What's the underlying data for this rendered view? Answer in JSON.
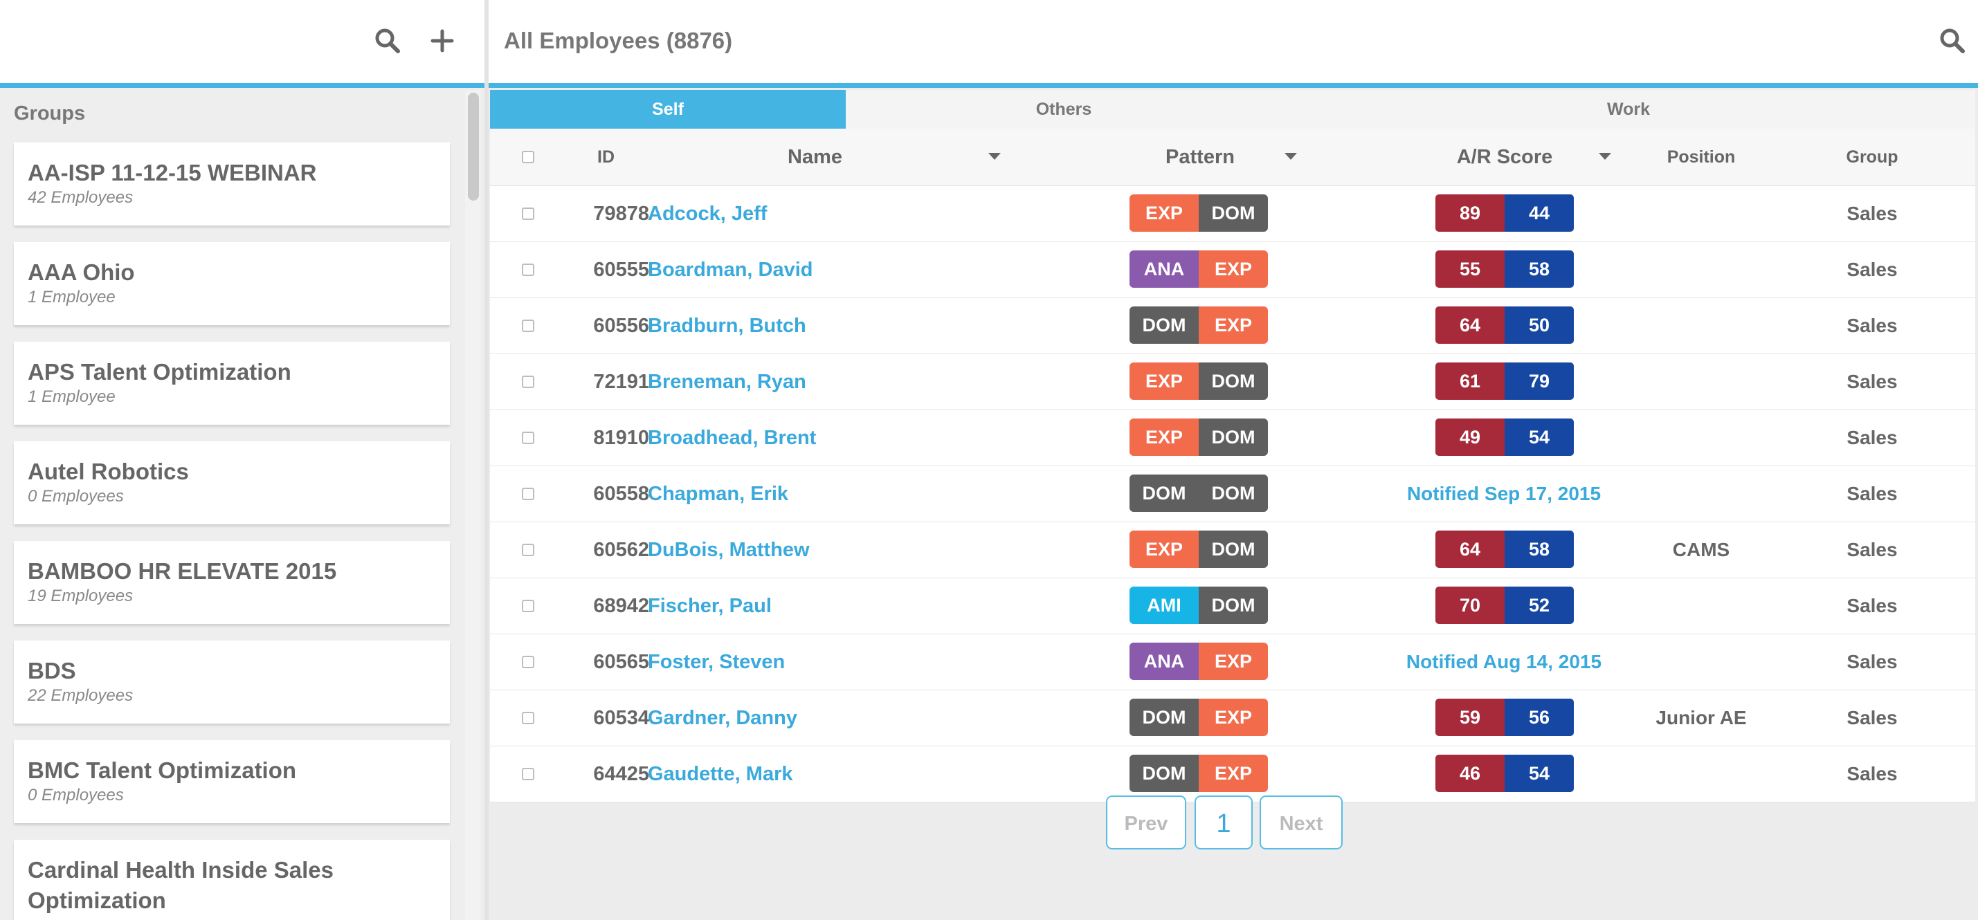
{
  "colors": {
    "accent": "#44b4e3",
    "link": "#3aa9dc",
    "pattern": {
      "EXP": "#f26b4b",
      "DOM": "#5f5f5f",
      "ANA": "#8a5aac",
      "AMI": "#17b5e6"
    },
    "a_score": "#a62a3a",
    "r_score": "#1648a3"
  },
  "sidebar": {
    "toolbar_icons": [
      "search-icon",
      "plus-icon"
    ],
    "groups_label": "Groups",
    "groups": [
      {
        "name": "AA-ISP 11-12-15 WEBINAR",
        "count": "42 Employees"
      },
      {
        "name": "AAA Ohio",
        "count": "1 Employee"
      },
      {
        "name": "APS Talent Optimization",
        "count": "1 Employee"
      },
      {
        "name": "Autel Robotics",
        "count": "0 Employees"
      },
      {
        "name": "BAMBOO HR ELEVATE 2015",
        "count": "19 Employees"
      },
      {
        "name": "BDS",
        "count": "22 Employees"
      },
      {
        "name": "BMC Talent Optimization",
        "count": "0 Employees"
      },
      {
        "name": "Cardinal Health Inside Sales Optimization",
        "count": ""
      }
    ]
  },
  "main": {
    "title": "All Employees (8876)",
    "search_icon": "search-icon",
    "tabs": [
      {
        "label": "Self",
        "active": true
      },
      {
        "label": "Others",
        "active": false
      },
      {
        "label": "Work",
        "active": false
      }
    ],
    "columns": {
      "id": "ID",
      "name": "Name",
      "pattern": "Pattern",
      "score": "A/R Score",
      "position": "Position",
      "group": "Group"
    },
    "rows": [
      {
        "id": "79878",
        "name": "Adcock, Jeff",
        "pattern": [
          "EXP",
          "DOM"
        ],
        "a": "89",
        "r": "44",
        "notified": "",
        "position": "",
        "group": "Sales"
      },
      {
        "id": "60555",
        "name": "Boardman, David",
        "pattern": [
          "ANA",
          "EXP"
        ],
        "a": "55",
        "r": "58",
        "notified": "",
        "position": "",
        "group": "Sales"
      },
      {
        "id": "60556",
        "name": "Bradburn, Butch",
        "pattern": [
          "DOM",
          "EXP"
        ],
        "a": "64",
        "r": "50",
        "notified": "",
        "position": "",
        "group": "Sales"
      },
      {
        "id": "72191",
        "name": "Breneman, Ryan",
        "pattern": [
          "EXP",
          "DOM"
        ],
        "a": "61",
        "r": "79",
        "notified": "",
        "position": "",
        "group": "Sales"
      },
      {
        "id": "81910",
        "name": "Broadhead, Brent",
        "pattern": [
          "EXP",
          "DOM"
        ],
        "a": "49",
        "r": "54",
        "notified": "",
        "position": "",
        "group": "Sales"
      },
      {
        "id": "60558",
        "name": "Chapman, Erik",
        "pattern": [
          "DOM",
          "DOM"
        ],
        "a": "",
        "r": "",
        "notified": "Notified Sep 17, 2015",
        "position": "",
        "group": "Sales"
      },
      {
        "id": "60562",
        "name": "DuBois, Matthew",
        "pattern": [
          "EXP",
          "DOM"
        ],
        "a": "64",
        "r": "58",
        "notified": "",
        "position": "CAMS",
        "group": "Sales"
      },
      {
        "id": "68942",
        "name": "Fischer, Paul",
        "pattern": [
          "AMI",
          "DOM"
        ],
        "a": "70",
        "r": "52",
        "notified": "",
        "position": "",
        "group": "Sales"
      },
      {
        "id": "60565",
        "name": "Foster, Steven",
        "pattern": [
          "ANA",
          "EXP"
        ],
        "a": "",
        "r": "",
        "notified": "Notified Aug 14, 2015",
        "position": "",
        "group": "Sales"
      },
      {
        "id": "60534",
        "name": "Gardner, Danny",
        "pattern": [
          "DOM",
          "EXP"
        ],
        "a": "59",
        "r": "56",
        "notified": "",
        "position": "Junior AE",
        "group": "Sales"
      },
      {
        "id": "64425",
        "name": "Gaudette, Mark",
        "pattern": [
          "DOM",
          "EXP"
        ],
        "a": "46",
        "r": "54",
        "notified": "",
        "position": "",
        "group": "Sales"
      }
    ],
    "pagination": {
      "prev": "Prev",
      "current": "1",
      "next": "Next"
    }
  }
}
